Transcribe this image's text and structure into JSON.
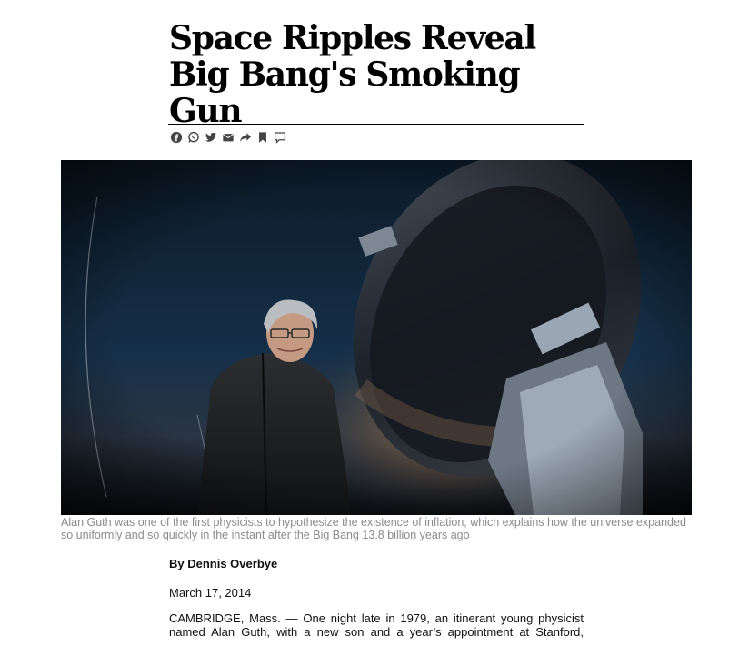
{
  "article": {
    "headline": "Space Ripples Reveal Big Bang's Smoking Gun",
    "share_icons": [
      "facebook-icon",
      "whatsapp-icon",
      "twitter-icon",
      "email-icon",
      "share-icon",
      "bookmark-icon",
      "comment-icon"
    ],
    "caption": "Alan Guth was one of the first physicists to hypothesize the existence of inflation, which explains how the universe expanded so uniformly and so quickly in the instant after the Big Bang 13.8 billion years ago",
    "byline": "By Dennis Overbye",
    "date": "March 17, 2014",
    "body_text": "CAMBRIDGE, Mass. — One night late in 1979, an itinerant young physicist named Alan Guth, with a new son and a year’s appointment at Stanford,"
  },
  "colors": {
    "rule": "#000000",
    "icon": "#444444",
    "caption": "#8a8a8a",
    "sky_top": "#0e1c2c",
    "sky_glow": "#b98a58"
  }
}
